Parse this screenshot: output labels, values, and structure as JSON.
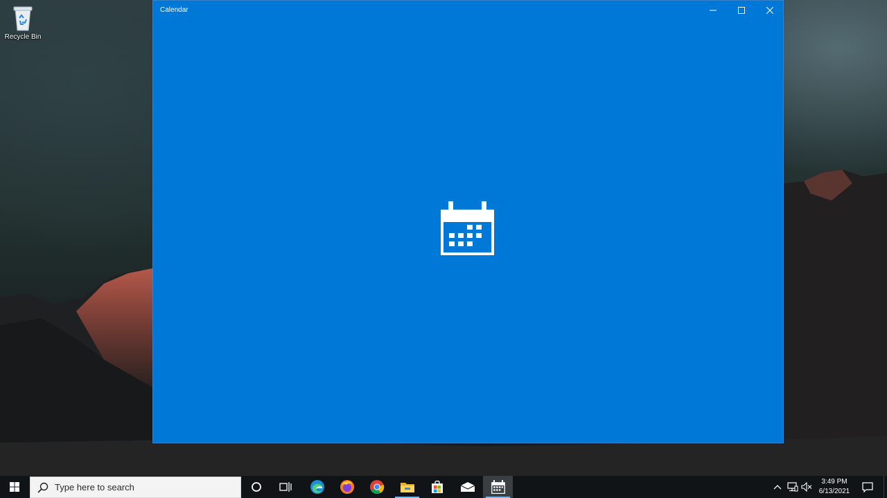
{
  "desktop": {
    "icons": [
      {
        "label": "Recycle Bin",
        "icon": "recycle-bin-icon"
      }
    ]
  },
  "window": {
    "title": "Calendar",
    "accent": "#0078d7",
    "controls": {
      "minimize": "minimize-icon",
      "maximize": "maximize-icon",
      "close": "close-icon"
    },
    "splash_icon": "calendar-icon"
  },
  "taskbar": {
    "search_placeholder": "Type here to search",
    "apps": [
      "edge",
      "firefox",
      "chrome",
      "file-explorer",
      "microsoft-store",
      "mail",
      "calendar"
    ],
    "active_app": "calendar",
    "clock": {
      "time": "3:49 PM",
      "date": "6/13/2021"
    }
  }
}
